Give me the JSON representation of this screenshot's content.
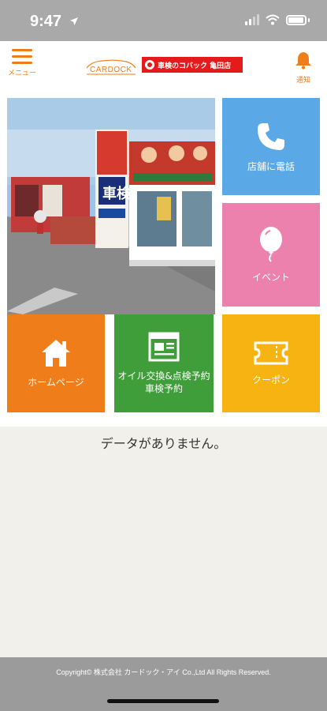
{
  "status_bar": {
    "time": "9:47"
  },
  "header": {
    "menu_label": "メニュー",
    "logo_cardock": "CARDOCK",
    "logo_kobac": "車検のコバック 亀田店",
    "notify_label": "通知",
    "accent_color": "#ef7d1a"
  },
  "tiles": {
    "phone": {
      "label": "店舗に電話",
      "icon": "phone-icon",
      "color": "#5aa8e6"
    },
    "event": {
      "label": "イベント",
      "icon": "balloon-icon",
      "color": "#ec81ad"
    },
    "home": {
      "label": "ホームページ",
      "icon": "house-icon",
      "color": "#ef7d1a"
    },
    "oil": {
      "label_line1": "オイル交換&点検予約",
      "label_line2": "車検予約",
      "icon": "browser-form-icon",
      "color": "#3f9e3a"
    },
    "coupon": {
      "label": "クーポン",
      "icon": "ticket-icon",
      "color": "#f6b312"
    }
  },
  "photo": {
    "sign_text": "車検",
    "description_icon": "store-photo"
  },
  "content": {
    "empty_message": "データがありません。"
  },
  "footer": {
    "copyright": "Copyright© 株式会社 カードック・アイ Co.,Ltd All Rights Reserved."
  }
}
